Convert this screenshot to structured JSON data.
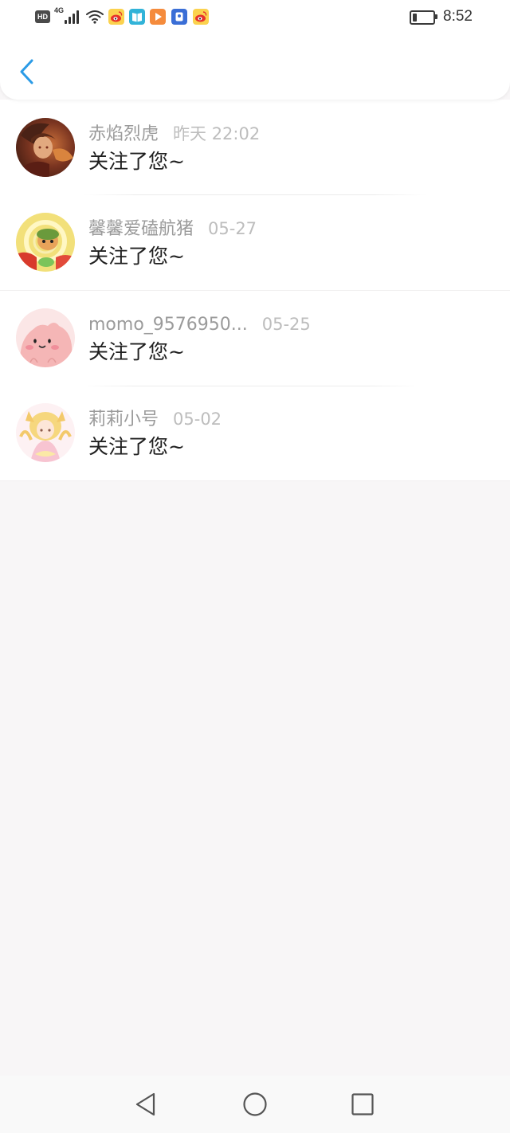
{
  "status_bar": {
    "hd_badge": "HD",
    "network": "4G",
    "signal_bars": 4,
    "signal_bars_max": 4,
    "battery_percent": 20,
    "time": "8:52",
    "notification_icons": [
      "weibo-icon",
      "book-app-icon",
      "play-app-icon",
      "blue-app-icon",
      "weibo-icon"
    ]
  },
  "header": {
    "back_icon": "chevron-left-icon"
  },
  "theme": {
    "accent": "#2b9be6",
    "name_color": "#9b9b9b",
    "time_color": "#bdbdbd",
    "message_color": "#1f1f1f"
  },
  "notifications": [
    {
      "name": "赤焰烈虎",
      "time": "昨天 22:02",
      "message": "关注了您~"
    },
    {
      "name": "馨馨爱磕航猪",
      "time": "05-27",
      "message": "关注了您~"
    },
    {
      "name": "momo_9576950...",
      "time": "05-25",
      "message": "关注了您~"
    },
    {
      "name": "莉莉小号",
      "time": "05-02",
      "message": "关注了您~"
    }
  ],
  "nav_bar": {
    "icons": [
      "back-triangle-icon",
      "home-circle-icon",
      "recents-square-icon"
    ]
  }
}
